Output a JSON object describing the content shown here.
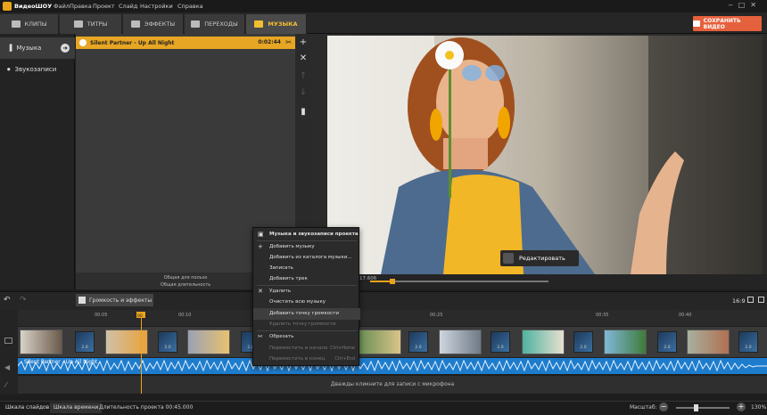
{
  "app": {
    "title": "ВидеоШОУ",
    "menu": [
      "Файл",
      "Правка",
      "Проект",
      "Слайд",
      "Настройки",
      "Справка"
    ]
  },
  "tabs": [
    {
      "label": "КЛИПЫ",
      "icon": "film-icon"
    },
    {
      "label": "ТИТРЫ",
      "icon": "titles-icon"
    },
    {
      "label": "ЭФФЕКТЫ",
      "icon": "effects-icon"
    },
    {
      "label": "ПЕРЕХОДЫ",
      "icon": "transitions-icon"
    },
    {
      "label": "МУЗЫКА",
      "icon": "music-note-icon",
      "active": true
    }
  ],
  "save_button": "СОХРАНИТЬ ВИДЕО",
  "sidebar": {
    "items": [
      {
        "label": "Музыка",
        "active": true
      },
      {
        "label": "Звукозаписи"
      }
    ]
  },
  "music_list": {
    "track": {
      "name": "Silent Partner - Up All Night",
      "duration": "0:02:44"
    },
    "footer_line1": "Общая для пользо",
    "footer_line2": "Общая длительность"
  },
  "preview": {
    "edit_button": "Редактировать",
    "time": "17.606"
  },
  "timeline": {
    "volume_button": "Громкость и эффекты",
    "aspect": "16:9",
    "ticks": [
      "00:05",
      "00:10",
      "00:25",
      "00:35",
      "00:40"
    ],
    "playhead_label": "00",
    "transition_duration": "2.0",
    "audio_label": "Silent Partner - Up All Night",
    "mic_hint": "Дважды кликните для записи с микрофона"
  },
  "status": {
    "tab_slides": "Шкала слайдов",
    "tab_time": "Шкала времени",
    "duration": "Длительность проекта 00:45.000",
    "zoom_label": "Масштаб:",
    "zoom_value": "130%"
  },
  "context_menu": {
    "header": "Музыка и звукозаписи проекта",
    "items": [
      {
        "label": "Добавить музыку",
        "icon": "+"
      },
      {
        "label": "Добавить из каталога музыки..."
      },
      {
        "label": "Записать"
      },
      {
        "label": "Добавить трек"
      },
      {
        "label": "Удалить",
        "icon": "✕"
      },
      {
        "label": "Очистить всю музыку"
      },
      {
        "label": "Добавить точку громкости",
        "highlight": true
      },
      {
        "label": "Удалить точку громкости",
        "disabled": true
      },
      {
        "label": "Обрезать",
        "icon": "✂"
      },
      {
        "label": "Переместить в начало",
        "shortcut": "Ctrl+Home",
        "disabled": true
      },
      {
        "label": "Переместить в конец",
        "shortcut": "Ctrl+End",
        "disabled": true
      }
    ]
  },
  "colors": {
    "accent": "#e9a41c",
    "save": "#e5603c",
    "audio": "#1e7ccc"
  }
}
